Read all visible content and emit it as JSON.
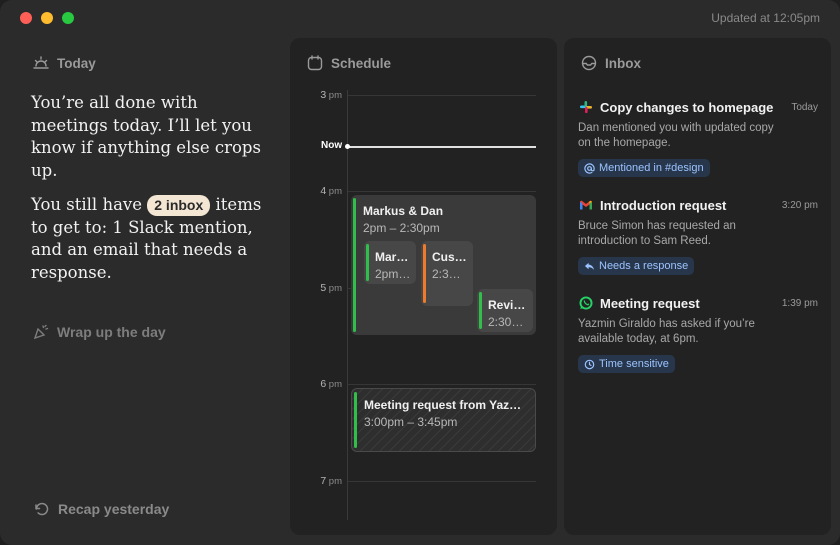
{
  "window": {
    "updated": "Updated at 12:05pm"
  },
  "today": {
    "heading": "Today",
    "summary_1": "You’re all done with meetings today. I’ll let you know if anything else crops up.",
    "summary_2_pre": "You still have",
    "inbox_pill": "2 inbox",
    "summary_2_post": "items to get to: 1 Slack mention, and an email that needs a response.",
    "wrap_label": "Wrap up the day",
    "recap_label": "Recap yesterday"
  },
  "schedule": {
    "heading": "Schedule",
    "hours": [
      {
        "num": "3",
        "suffix": "pm"
      },
      {
        "num": "4",
        "suffix": "pm"
      },
      {
        "num": "5",
        "suffix": "pm"
      },
      {
        "num": "6",
        "suffix": "pm"
      },
      {
        "num": "7",
        "suffix": "pm"
      }
    ],
    "now_label": "Now",
    "events": [
      {
        "title": "Markus & Dan",
        "time": "2pm – 2:30pm",
        "color": "#2fbf4a"
      },
      {
        "title": "Mar…",
        "time": "2pm…",
        "color": "#2fbf4a"
      },
      {
        "title": "Cus…",
        "time": "2:3…",
        "color": "#f07a2a"
      },
      {
        "title": "Revi…",
        "time": "2:30…",
        "color": "#2fbf4a"
      },
      {
        "title": "Meeting request from Yaz…",
        "time": "3:00pm – 3:45pm",
        "color": "#2fbf4a"
      }
    ]
  },
  "inbox": {
    "heading": "Inbox",
    "items": [
      {
        "app": "slack-icon",
        "title": "Copy changes to homepage",
        "time": "Today",
        "body": "Dan mentioned you with updated copy on the homepage.",
        "tag": "Mentioned in #design",
        "tag_icon": "at-icon"
      },
      {
        "app": "gmail-icon",
        "title": "Introduction request",
        "time": "3:20 pm",
        "body": "Bruce Simon has requested an introduction to Sam Reed.",
        "tag": "Needs a response",
        "tag_icon": "reply-icon"
      },
      {
        "app": "whatsapp-icon",
        "title": "Meeting request",
        "time": "1:39 pm",
        "body": "Yazmin Giraldo has asked if you’re available today, at 6pm.",
        "tag": "Time sensitive",
        "tag_icon": "clock-icon"
      }
    ]
  }
}
